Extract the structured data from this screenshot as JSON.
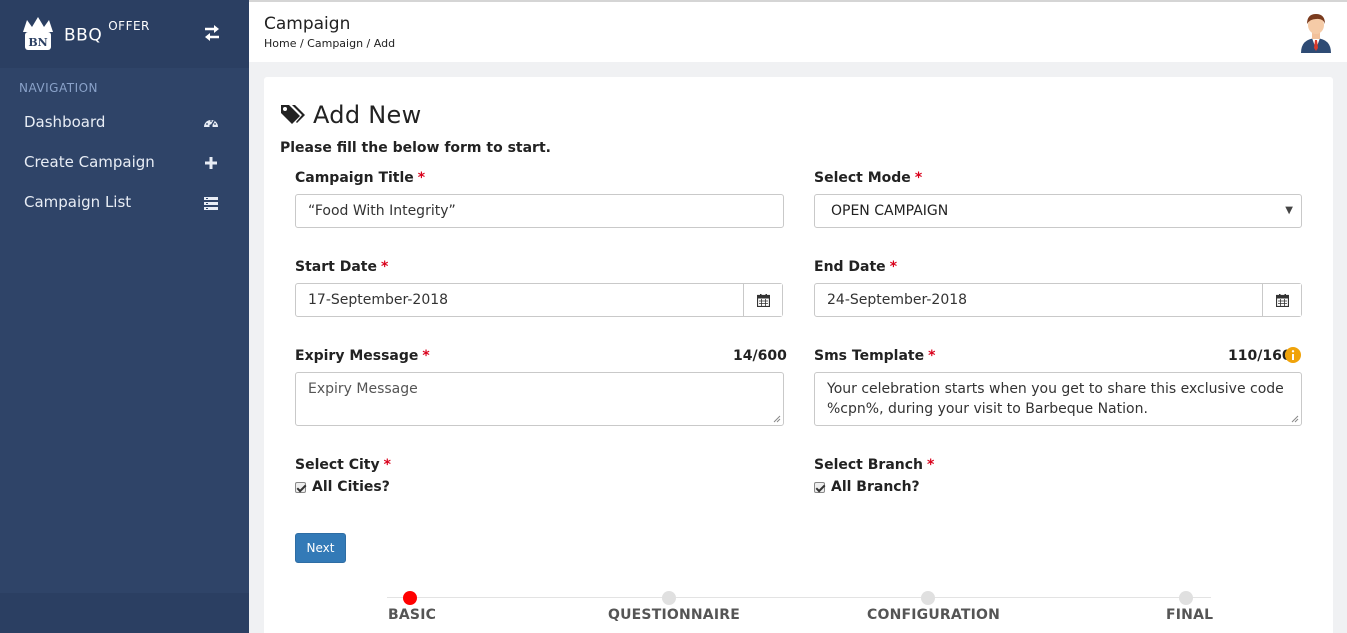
{
  "brand": {
    "name": "BBQ",
    "suffix": "OFFER",
    "logo_text": "BN"
  },
  "sidebar": {
    "section_title": "NAVIGATION",
    "items": [
      {
        "label": "Dashboard",
        "icon": "dashboard-gauge-icon"
      },
      {
        "label": "Create Campaign",
        "icon": "plus-icon"
      },
      {
        "label": "Campaign List",
        "icon": "list-icon"
      }
    ]
  },
  "header": {
    "title": "Campaign",
    "breadcrumb": "Home / Campaign / Add",
    "avatar_icon": "user-avatar-icon"
  },
  "form": {
    "heading": "Add New",
    "subheading": "Please fill the below form to start.",
    "campaign_title": {
      "label": "Campaign Title",
      "value": "“Food With Integrity”"
    },
    "select_mode": {
      "label": "Select Mode",
      "value": "OPEN CAMPAIGN"
    },
    "start_date": {
      "label": "Start Date",
      "value": "17-September-2018"
    },
    "end_date": {
      "label": "End Date",
      "value": "24-September-2018"
    },
    "expiry_message": {
      "label": "Expiry Message",
      "counter": "14/600",
      "placeholder": "Expiry Message"
    },
    "sms_template": {
      "label": "Sms Template",
      "counter": "110/160",
      "value": "Your celebration starts when you get to share this exclusive code %cpn%, during your visit to Barbeque Nation."
    },
    "select_city": {
      "label": "Select City",
      "checkbox_label": "All Cities?",
      "checked": true
    },
    "select_branch": {
      "label": "Select Branch",
      "checkbox_label": "All Branch?",
      "checked": true
    },
    "required_mark": "*",
    "next_button": "Next"
  },
  "stepper": {
    "steps": [
      {
        "label": "BASIC",
        "active": true
      },
      {
        "label": "QUESTIONNAIRE",
        "active": false
      },
      {
        "label": "CONFIGURATION",
        "active": false
      },
      {
        "label": "FINAL",
        "active": false
      }
    ]
  },
  "colors": {
    "sidebar_bg": "#2f4468",
    "primary_button": "#337ab7",
    "required": "#d9001b",
    "active_step": "#ff0000",
    "info_icon": "#f0a30a"
  }
}
